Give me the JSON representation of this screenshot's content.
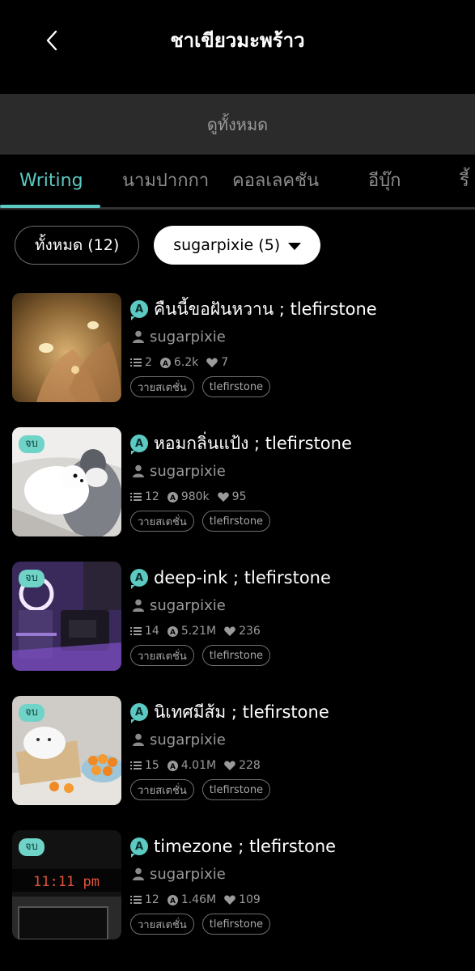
{
  "header": {
    "title": "ชาเขียวมะพร้าว"
  },
  "view_all": "ดูทั้งหมด",
  "tabs": [
    {
      "label": "Writing",
      "active": true
    },
    {
      "label": "นามปากกา"
    },
    {
      "label": "คอลเลคชัน"
    },
    {
      "label": "อีบุ๊ก"
    },
    {
      "label": "รี้"
    }
  ],
  "filters": {
    "all": "ทั้งหมด (12)",
    "author": "sugarpixie (5)"
  },
  "colors": {
    "accent": "#5cc9c2",
    "badge": "#6fd3c8"
  },
  "items": [
    {
      "title": "คืนนี้ขอฝันหวาน ; tlefirstone",
      "author": "sugarpixie",
      "chapters": "2",
      "views": "6.2k",
      "likes": "7",
      "tags": [
        "วายสเตชั่น",
        "tlefirstone"
      ],
      "badge": ""
    },
    {
      "title": "หอมกลิ่นแป้ง ; tlefirstone",
      "author": "sugarpixie",
      "chapters": "12",
      "views": "980k",
      "likes": "95",
      "tags": [
        "วายสเตชั่น",
        "tlefirstone"
      ],
      "badge": "จบ"
    },
    {
      "title": "deep-ink ; tlefirstone",
      "author": "sugarpixie",
      "chapters": "14",
      "views": "5.21M",
      "likes": "236",
      "tags": [
        "วายสเตชั่น",
        "tlefirstone"
      ],
      "badge": "จบ"
    },
    {
      "title": "นิเทศมีส้ม ; tlefirstone",
      "author": "sugarpixie",
      "chapters": "15",
      "views": "4.01M",
      "likes": "228",
      "tags": [
        "วายสเตชั่น",
        "tlefirstone"
      ],
      "badge": "จบ"
    },
    {
      "title": "timezone ; tlefirstone",
      "author": "sugarpixie",
      "chapters": "12",
      "views": "1.46M",
      "likes": "109",
      "tags": [
        "วายสเตชั่น",
        "tlefirstone"
      ],
      "badge": "จบ"
    }
  ],
  "thumb_text": {
    "clock": "11:11 pm"
  }
}
